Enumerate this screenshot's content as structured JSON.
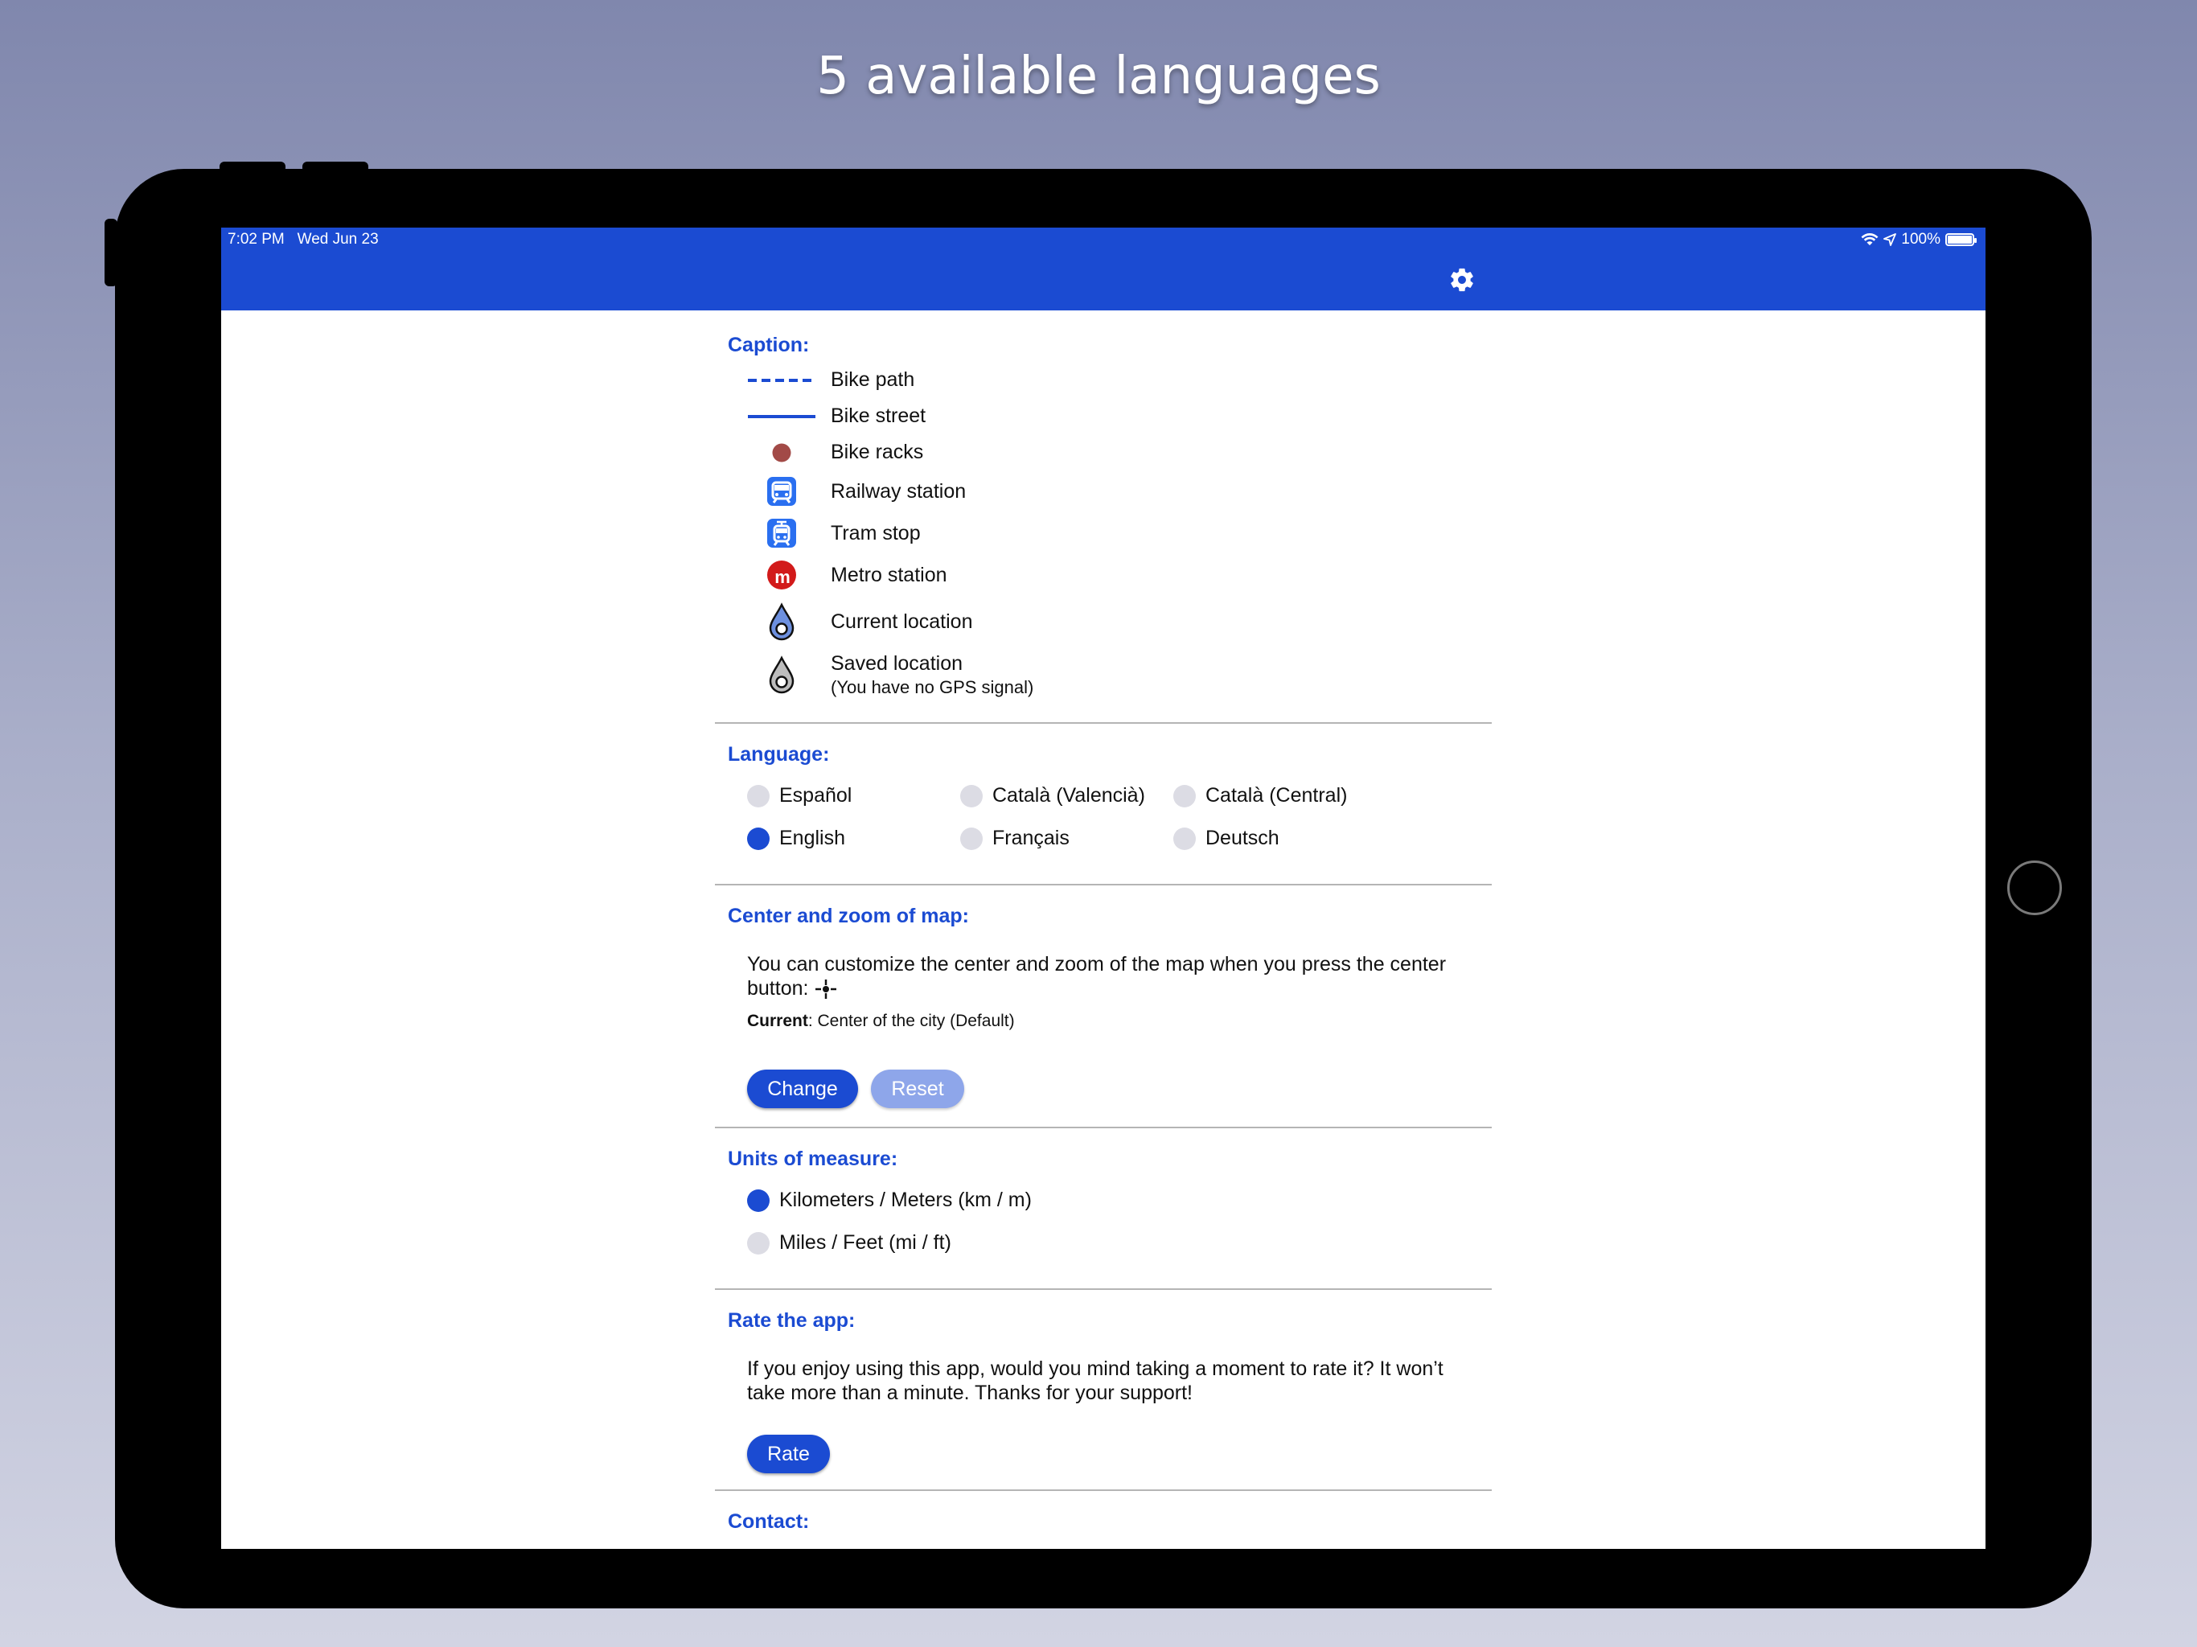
{
  "promo": {
    "headline": "5 available languages"
  },
  "status_bar": {
    "time": "7:02 PM",
    "date": "Wed Jun 23",
    "battery": "100%",
    "battery_level": 1.0
  },
  "header": {
    "settings_icon": "gear-icon"
  },
  "colors": {
    "accent": "#1b4bd2",
    "accent_disabled": "#8ea6ea",
    "bike_racks": "#a24a47",
    "metro": "#d21a1a"
  },
  "caption": {
    "title": "Caption:",
    "items": [
      {
        "icon": "dashed-line",
        "label": "Bike path"
      },
      {
        "icon": "solid-line",
        "label": "Bike street"
      },
      {
        "icon": "bike-rack-dot",
        "label": "Bike racks"
      },
      {
        "icon": "train-icon",
        "label": "Railway station"
      },
      {
        "icon": "tram-icon",
        "label": "Tram stop"
      },
      {
        "icon": "metro-icon",
        "label": "Metro station"
      },
      {
        "icon": "current-location-pin",
        "label": "Current location"
      },
      {
        "icon": "saved-location-pin",
        "label": "Saved location",
        "sublabel": "(You have no GPS signal)"
      }
    ]
  },
  "language": {
    "title": "Language:",
    "options": [
      {
        "label": "Español",
        "selected": false
      },
      {
        "label": "Català (Valencià)",
        "selected": false
      },
      {
        "label": "Català (Central)",
        "selected": false
      },
      {
        "label": "English",
        "selected": true
      },
      {
        "label": "Français",
        "selected": false
      },
      {
        "label": "Deutsch",
        "selected": false
      }
    ]
  },
  "map_center": {
    "title": "Center and zoom of map:",
    "description_line1": "You can customize the center and zoom of the map when you press the center",
    "description_line2": "button:",
    "button_icon": "crosshair-icon",
    "current_label": "Current",
    "current_value": ": Center of the city (Default)",
    "change_label": "Change",
    "reset_label": "Reset"
  },
  "units": {
    "title": "Units of measure:",
    "options": [
      {
        "label": "Kilometers / Meters (km / m)",
        "selected": true
      },
      {
        "label": "Miles / Feet (mi / ft)",
        "selected": false
      }
    ]
  },
  "rate": {
    "title": "Rate the app:",
    "description_line1": "If you enjoy using this app, would you mind taking a moment to rate it? It won’t",
    "description_line2": "take more than a minute. Thanks for your support!",
    "button_label": "Rate"
  },
  "contact": {
    "title": "Contact:"
  }
}
